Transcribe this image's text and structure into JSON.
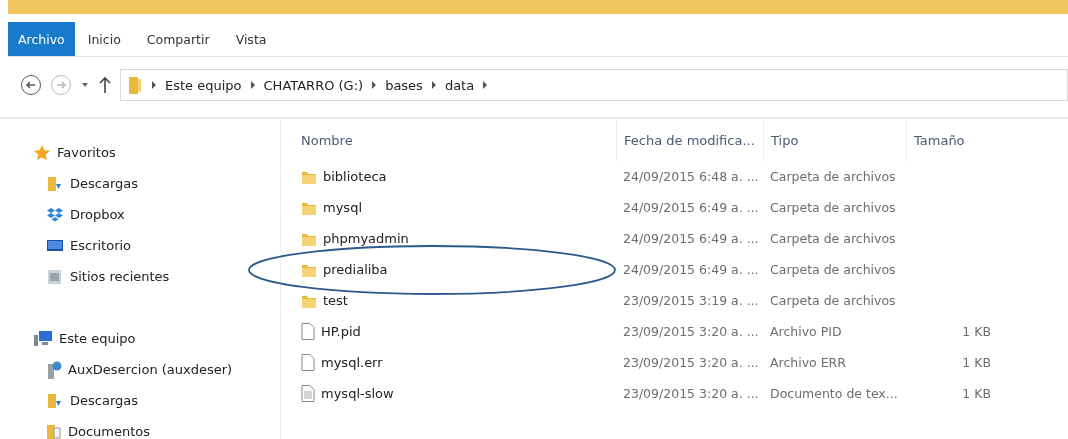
{
  "ribbon": {
    "tabs": [
      {
        "label": "Archivo",
        "selected": true
      },
      {
        "label": "Inicio",
        "selected": false
      },
      {
        "label": "Compartir",
        "selected": false
      },
      {
        "label": "Vista",
        "selected": false
      }
    ]
  },
  "address_bar": {
    "path": [
      "Este equipo",
      "CHATARRO (G:)",
      "bases",
      "data"
    ]
  },
  "sidebar": {
    "groups": [
      {
        "label": "Favoritos",
        "kind": "star",
        "children": [
          {
            "label": "Descargas",
            "kind": "download"
          },
          {
            "label": "Dropbox",
            "kind": "dropbox"
          },
          {
            "label": "Escritorio",
            "kind": "desktop"
          },
          {
            "label": "Sitios recientes",
            "kind": "recent"
          }
        ]
      },
      {
        "label": "Este equipo",
        "kind": "pc",
        "children": [
          {
            "label": "AuxDesercion (auxdeser)",
            "kind": "network"
          },
          {
            "label": "Descargas",
            "kind": "download"
          },
          {
            "label": "Documentos",
            "kind": "documents"
          }
        ]
      }
    ]
  },
  "table": {
    "columns": [
      "Nombre",
      "Fecha de modifica...",
      "Tipo",
      "Tamaño"
    ],
    "rows": [
      {
        "name": "biblioteca",
        "kind": "folder",
        "date": "24/09/2015 6:48 a. ...",
        "type": "Carpeta de archivos",
        "circled": false
      },
      {
        "name": "mysql",
        "kind": "folder",
        "date": "24/09/2015 6:49 a. ...",
        "type": "Carpeta de archivos",
        "circled": false
      },
      {
        "name": "phpmyadmin",
        "kind": "folder",
        "date": "24/09/2015 6:49 a. ...",
        "type": "Carpeta de archivos",
        "circled": false
      },
      {
        "name": "predialiba",
        "kind": "folder",
        "date": "24/09/2015 6:49 a. ...",
        "type": "Carpeta de archivos",
        "circled": true
      },
      {
        "name": "test",
        "kind": "folder",
        "date": "23/09/2015 3:19 a. ...",
        "type": "Carpeta de archivos",
        "circled": false
      },
      {
        "name": "HP.pid",
        "kind": "file",
        "date": "23/09/2015 3:20 a. ...",
        "type": "Archivo PID",
        "size": "1 KB",
        "circled": false
      },
      {
        "name": "mysql.err",
        "kind": "file",
        "date": "23/09/2015 3:20 a. ...",
        "type": "Archivo ERR",
        "size": "1 KB",
        "circled": false
      },
      {
        "name": "mysql-slow",
        "kind": "text",
        "date": "23/09/2015 3:20 a. ...",
        "type": "Documento de tex...",
        "size": "1 KB",
        "circled": false
      }
    ]
  }
}
